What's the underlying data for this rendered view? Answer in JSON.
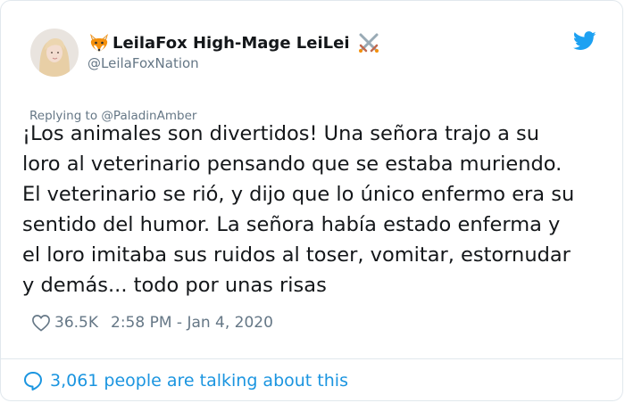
{
  "author": {
    "display_name": "LeilaFox High-Mage LeiLei",
    "handle": "@LeilaFoxNation",
    "avatar_icon": "profile-photo",
    "prefix_emoji_icon": "fox-face-icon",
    "suffix_emoji_icon": "crossed-swords-icon"
  },
  "reply_context": {
    "prefix": "Replying to",
    "target": "@PaladinAmber"
  },
  "tweet": {
    "lines": [
      "¡Los animales son divertidos! Una señora trajo a su",
      "loro al veterinario pensando que se estaba muriendo.",
      "El veterinario se rió, y dijo que lo único enfermo era su",
      "sentido del humor. La señora había estado enferma y",
      "el loro imitaba sus ruidos al toser, vomitar, estornudar",
      "y demás... todo por unas risas"
    ]
  },
  "meta": {
    "likes": "36.5K",
    "timestamp": "2:58 PM - Jan 4, 2020"
  },
  "footer": {
    "conversation_text": "3,061 people are talking about this"
  },
  "colors": {
    "text_primary": "#14171a",
    "text_secondary": "#657786",
    "twitter_blue": "#1da1f2",
    "link_blue": "#1b95e0",
    "border": "#e1e8ed"
  }
}
